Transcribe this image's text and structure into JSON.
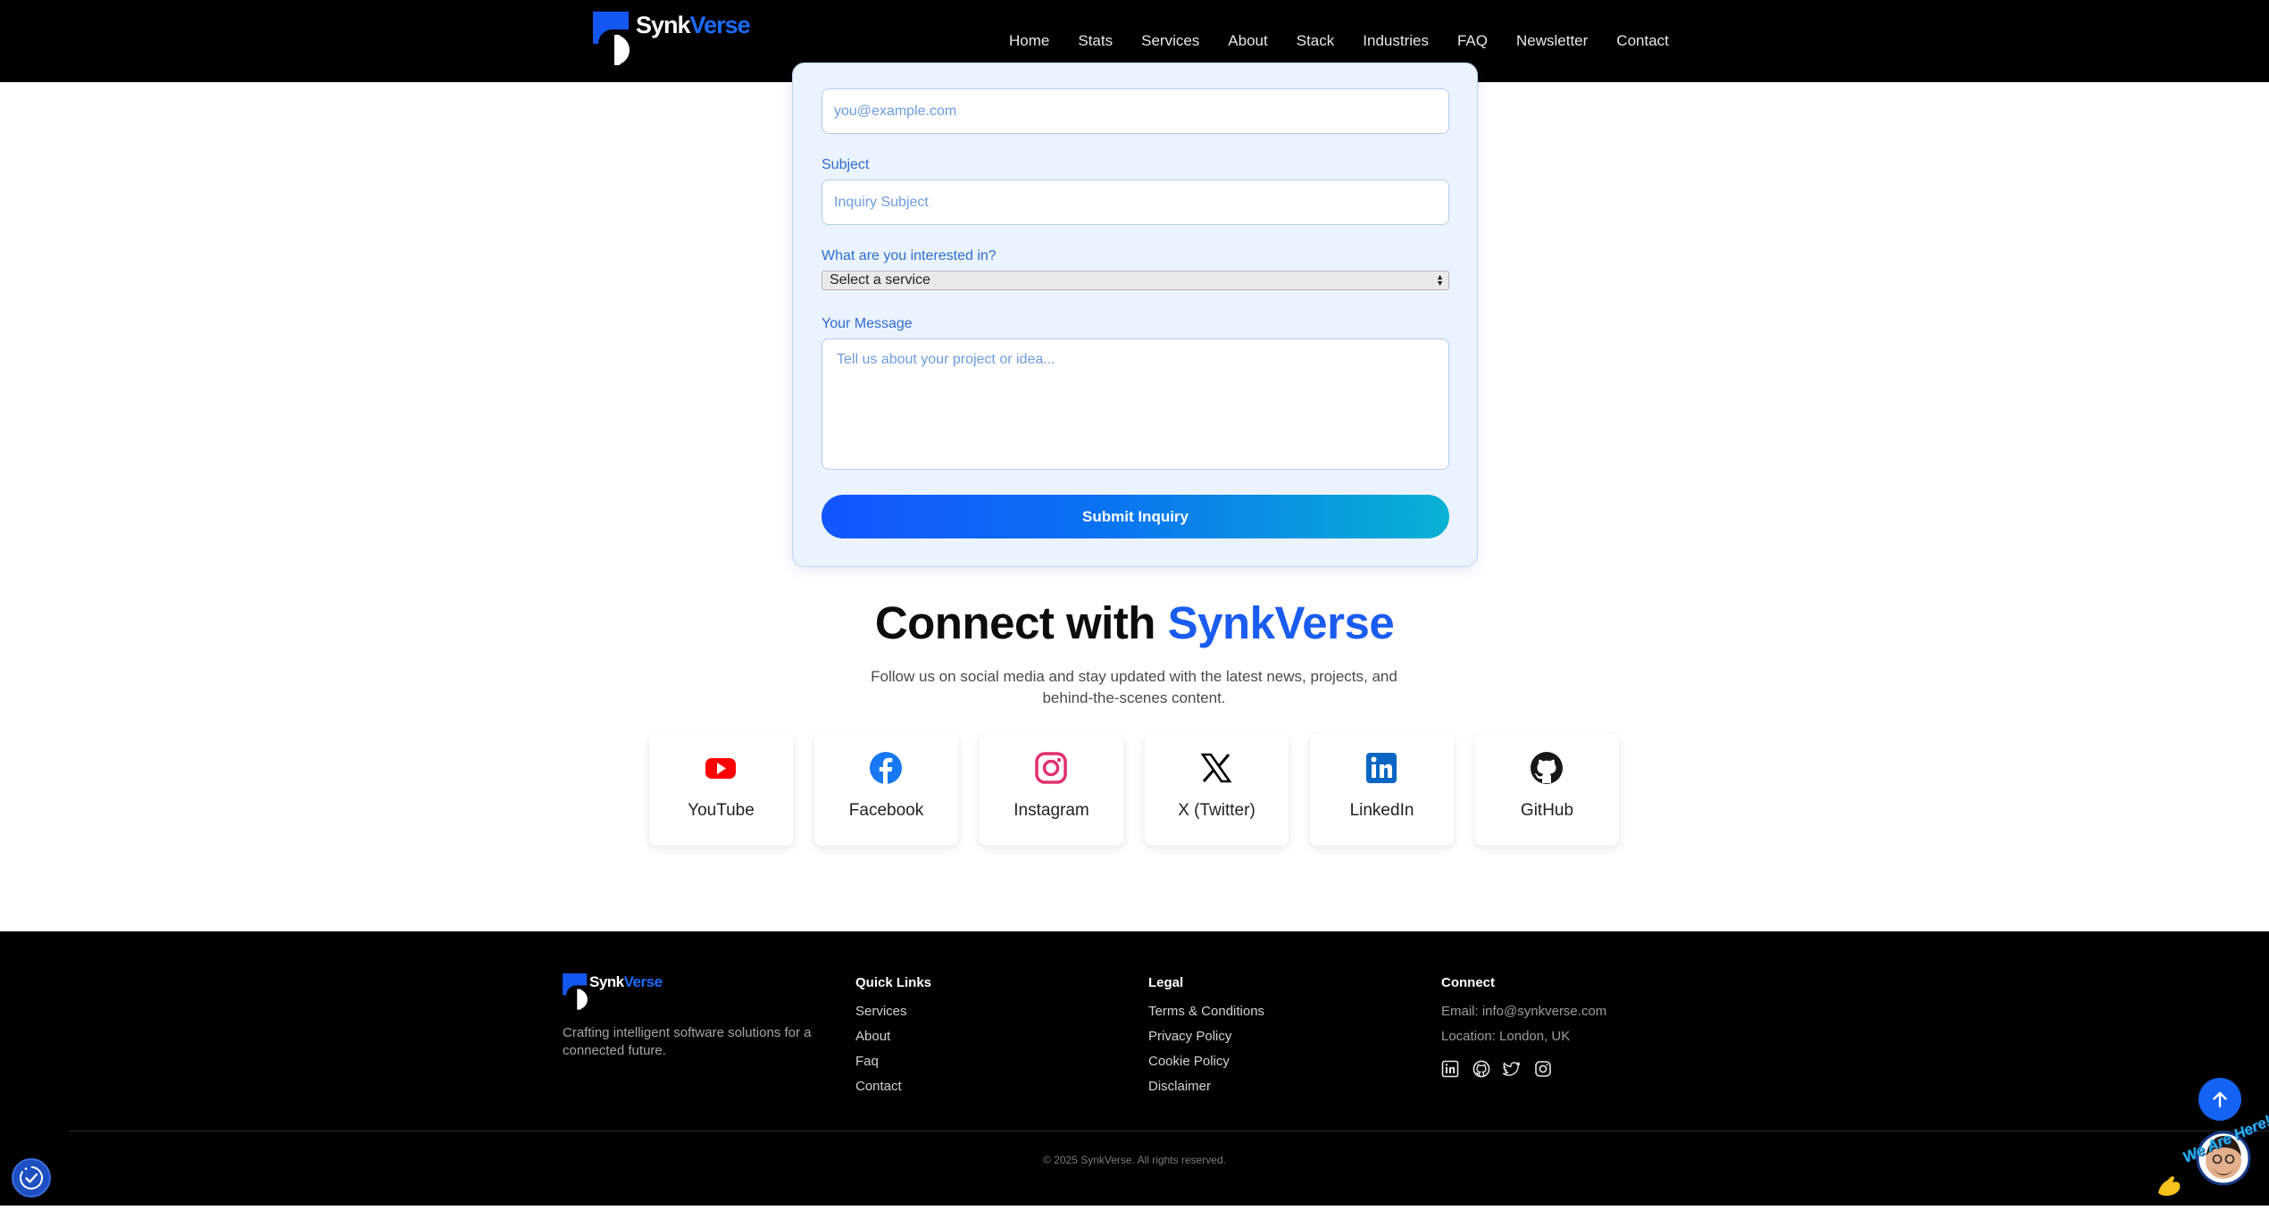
{
  "brand": {
    "part1": "Synk",
    "part2": "Verse"
  },
  "nav": {
    "links": [
      "Home",
      "Stats",
      "Services",
      "About",
      "Stack",
      "Industries",
      "FAQ",
      "Newsletter",
      "Contact"
    ]
  },
  "form": {
    "email_placeholder": "you@example.com",
    "subject_label": "Subject",
    "subject_placeholder": "Inquiry Subject",
    "interest_label": "What are you interested in?",
    "interest_selected": "Select a service",
    "message_label": "Your Message",
    "message_placeholder": "Tell us about your project or idea...",
    "submit_label": "Submit Inquiry"
  },
  "connect": {
    "title_prefix": "Connect with ",
    "title_brand": "SynkVerse",
    "subtitle": "Follow us on social media and stay updated with the latest news, projects, and behind-the-scenes content.",
    "socials": [
      {
        "label": "YouTube",
        "icon": "youtube-icon",
        "color": "#ff0000"
      },
      {
        "label": "Facebook",
        "icon": "facebook-icon",
        "color": "#1877f2"
      },
      {
        "label": "Instagram",
        "icon": "instagram-icon",
        "color": "#e1306c"
      },
      {
        "label": "X (Twitter)",
        "icon": "x-icon",
        "color": "#000000"
      },
      {
        "label": "LinkedIn",
        "icon": "linkedin-icon",
        "color": "#0a66c2"
      },
      {
        "label": "GitHub",
        "icon": "github-icon",
        "color": "#181717"
      }
    ]
  },
  "footer": {
    "tagline": "Crafting intelligent software solutions for a connected future.",
    "quick_links_title": "Quick Links",
    "quick_links": [
      "Services",
      "About",
      "Faq",
      "Contact"
    ],
    "legal_title": "Legal",
    "legal_links": [
      "Terms & Conditions",
      "Privacy Policy",
      "Cookie Policy",
      "Disclaimer"
    ],
    "connect_title": "Connect",
    "email": "Email: info@synkverse.com",
    "location": "Location: London, UK",
    "social_icons": [
      "linkedin-icon",
      "github-icon",
      "twitter-icon",
      "instagram-icon"
    ],
    "copyright": "© 2025 SynkVerse. All rights reserved."
  },
  "floating": {
    "chat_badge": "We Are Here!"
  },
  "colors": {
    "accent": "#1a5cf0",
    "button_gradient_start": "#1455ff",
    "button_gradient_end": "#08b2d3"
  }
}
